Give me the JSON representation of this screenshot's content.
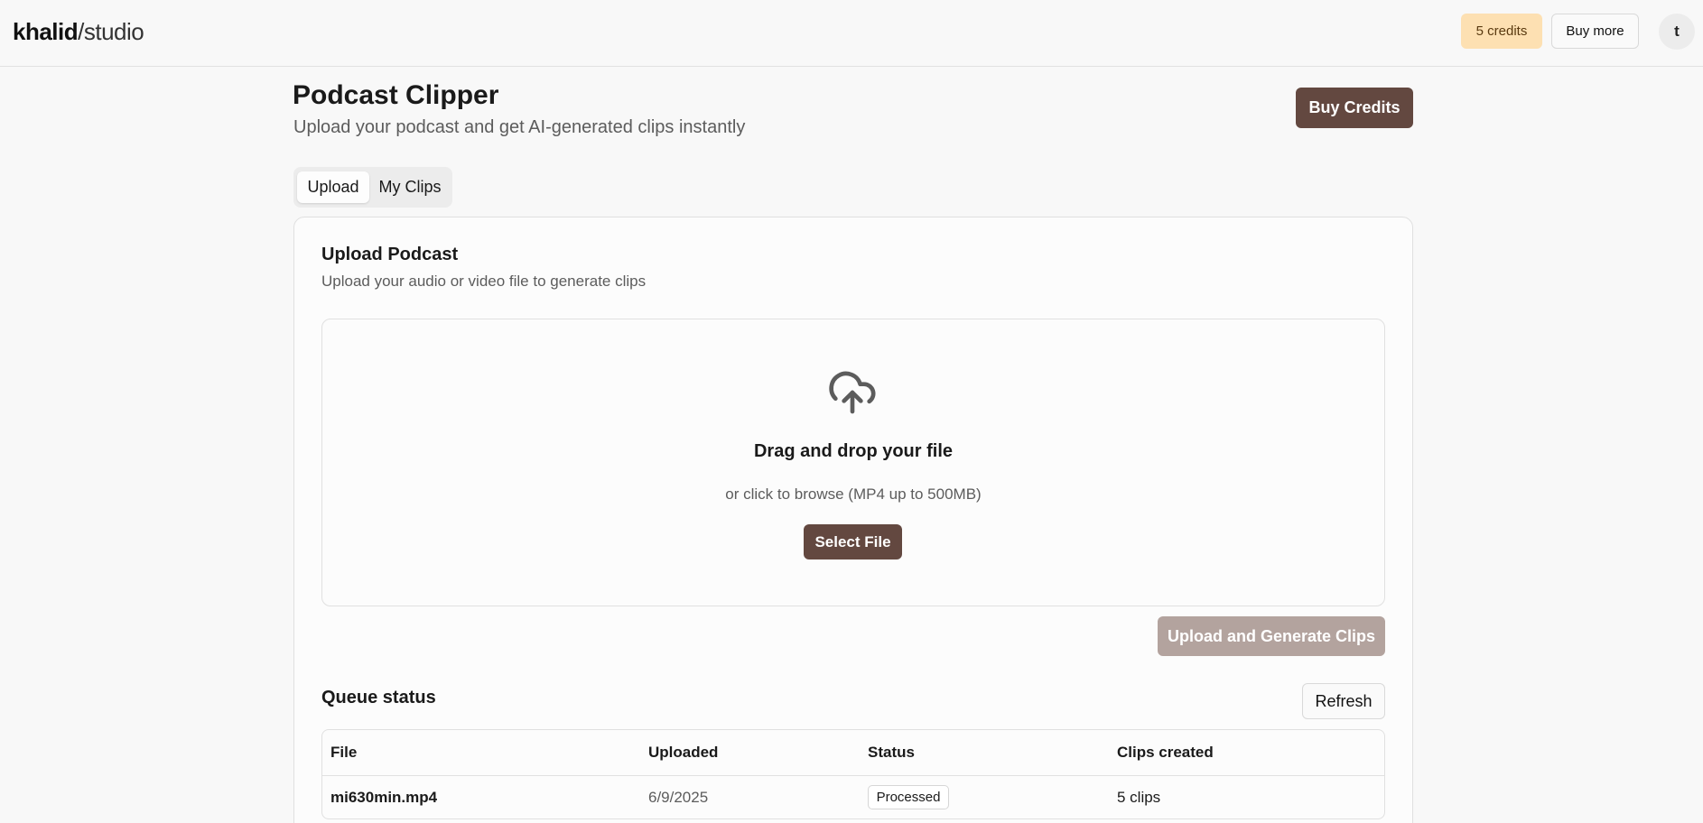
{
  "nav": {
    "brand": "khalid",
    "slash": "/",
    "sub": "studio",
    "credits": "5 credits",
    "buy_more": "Buy more",
    "avatar_initial": "t"
  },
  "header": {
    "title": "Podcast Clipper",
    "subtitle": "Upload your podcast and get AI-generated clips instantly",
    "buy_credits": "Buy Credits"
  },
  "tabs": [
    {
      "label": "Upload",
      "active": true
    },
    {
      "label": "My Clips",
      "active": false
    }
  ],
  "upload_card": {
    "title": "Upload Podcast",
    "subtitle": "Upload your audio or video file to generate clips",
    "dropzone": {
      "icon": "cloud-upload-icon",
      "heading": "Drag and drop your file",
      "hint": "or click to browse (MP4 up to 500MB)",
      "select_button": "Select File"
    },
    "submit_button": "Upload and Generate Clips"
  },
  "queue": {
    "title": "Queue status",
    "refresh_button": "Refresh",
    "columns": [
      "File",
      "Uploaded",
      "Status",
      "Clips created"
    ],
    "rows": [
      {
        "file": "mi630min.mp4",
        "uploaded": "6/9/2025",
        "status": "Processed",
        "clips": "5 clips"
      }
    ]
  },
  "colors": {
    "primary": "#634840",
    "primary_disabled": "#b3a39e",
    "credits_pill": "#fde0b2",
    "background": "#f8f8f8"
  }
}
